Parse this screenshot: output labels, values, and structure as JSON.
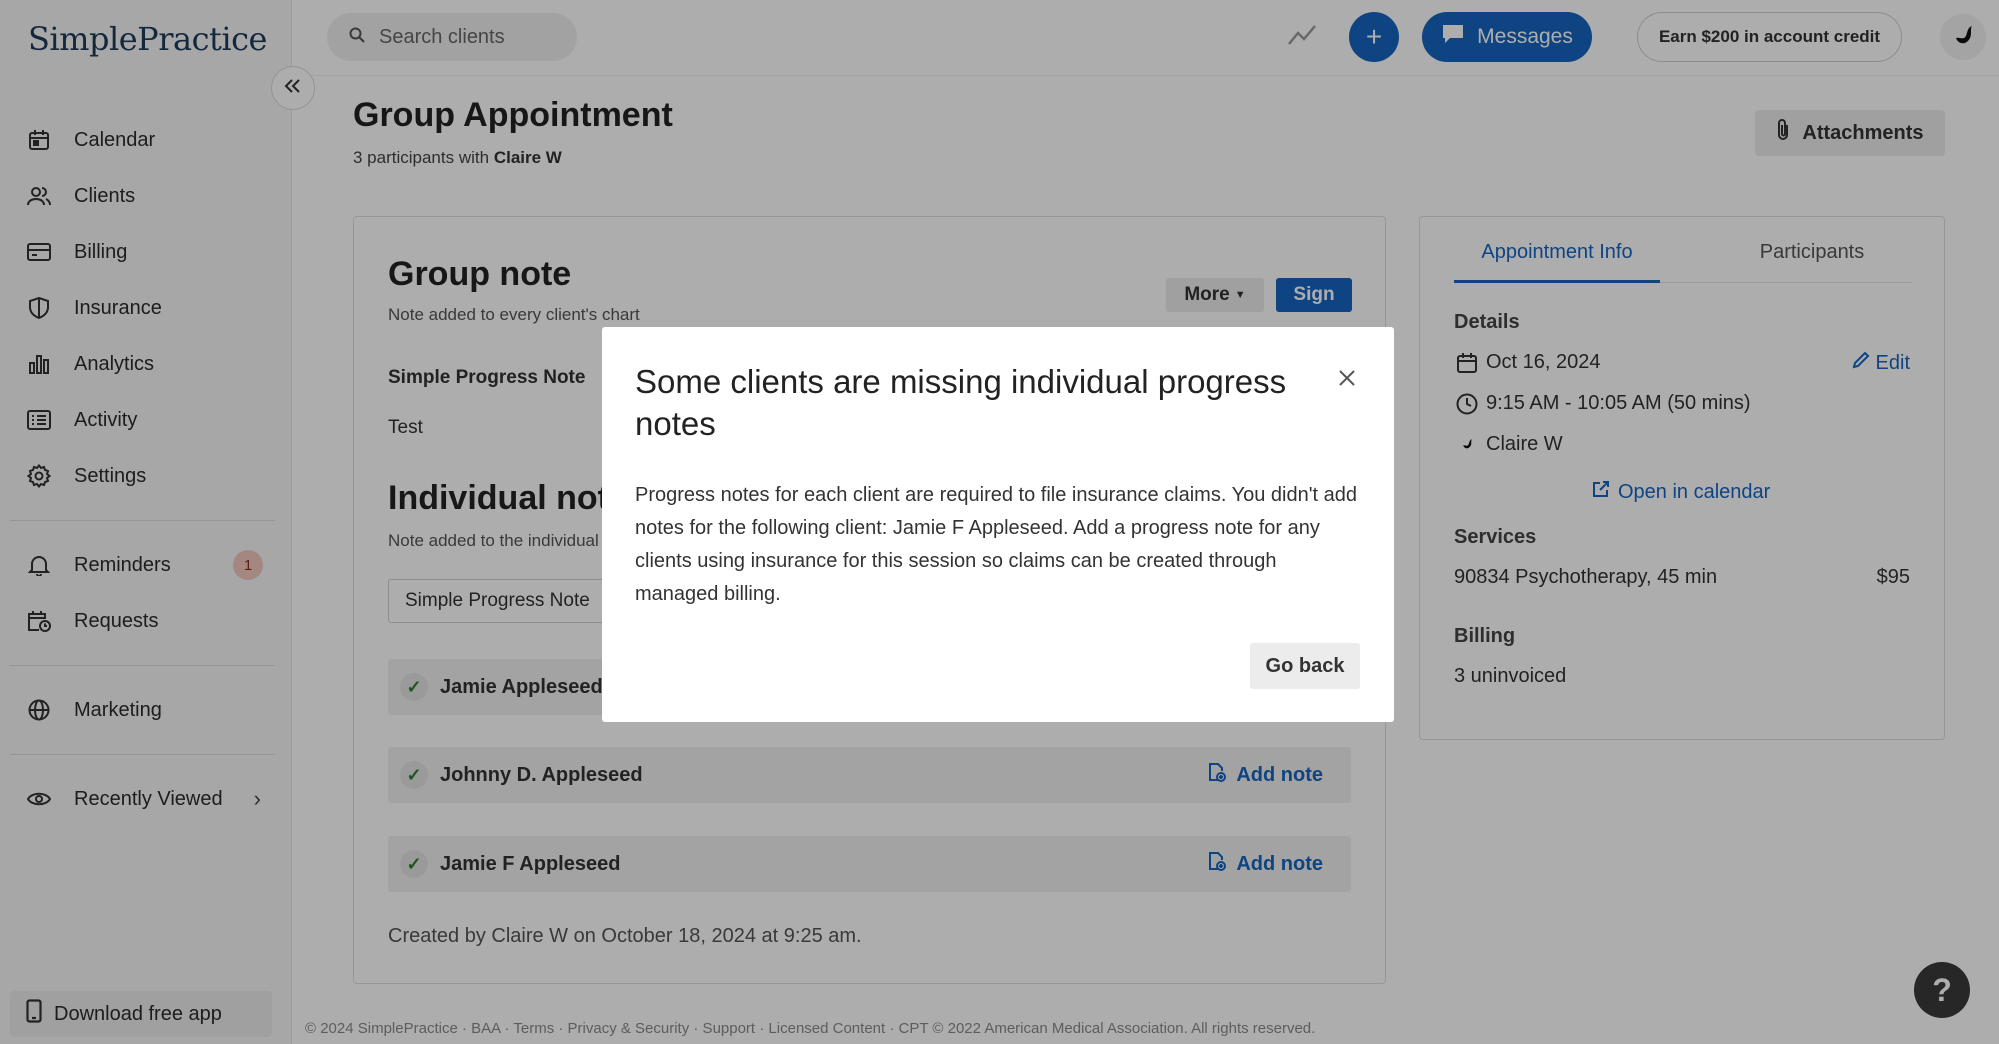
{
  "app": {
    "logo": "SimplePractice"
  },
  "sidebar": {
    "collapse_icon": "double-chevron-left-icon",
    "items": [
      {
        "label": "Calendar",
        "icon": "calendar-icon"
      },
      {
        "label": "Clients",
        "icon": "users-icon"
      },
      {
        "label": "Billing",
        "icon": "credit-card-icon"
      },
      {
        "label": "Insurance",
        "icon": "shield-icon"
      },
      {
        "label": "Analytics",
        "icon": "bar-chart-icon"
      },
      {
        "label": "Activity",
        "icon": "list-icon"
      },
      {
        "label": "Settings",
        "icon": "gear-icon"
      }
    ],
    "reminders": {
      "label": "Reminders",
      "badge": "1"
    },
    "requests": {
      "label": "Requests"
    },
    "marketing": {
      "label": "Marketing"
    },
    "recently_viewed": {
      "label": "Recently Viewed"
    },
    "download": {
      "label": "Download free app"
    }
  },
  "topbar": {
    "search_placeholder": "Search clients",
    "messages_label": "Messages",
    "credit_label": "Earn $200 in account credit"
  },
  "page": {
    "title": "Group Appointment",
    "subtitle_prefix": "3 participants with",
    "subtitle_name": "Claire W",
    "attachments_label": "Attachments"
  },
  "group_note": {
    "title": "Group note",
    "subtitle": "Note added to every client's chart",
    "more_label": "More",
    "sign_label": "Sign",
    "template_label": "Simple Progress Note",
    "text": "Test"
  },
  "individual_notes": {
    "title": "Individual notes",
    "subtitle": "Note added to the individual client's chart",
    "template_value": "Simple Progress Note",
    "clients": [
      {
        "name": "Jamie Appleseed",
        "action": ""
      },
      {
        "name": "Johnny D. Appleseed",
        "action": "Add note"
      },
      {
        "name": "Jamie F Appleseed",
        "action": "Add note"
      }
    ],
    "created_text": "Created by Claire W on October 18, 2024 at 9:25 am."
  },
  "info_panel": {
    "tabs": [
      "Appointment Info",
      "Participants"
    ],
    "details_label": "Details",
    "date": "Oct 16, 2024",
    "edit_label": "Edit",
    "time": "9:15 AM - 10:05 AM (50 mins)",
    "clinician": "Claire W",
    "open_calendar_label": "Open in calendar",
    "services_label": "Services",
    "service_name": "90834 Psychotherapy, 45 min",
    "service_price": "$95",
    "billing_label": "Billing",
    "billing_value": "3 uninvoiced"
  },
  "footer": {
    "text": "© 2024 SimplePractice · BAA · Terms · Privacy & Security · Support · Licensed Content · CPT © 2022 American Medical Association. All rights reserved."
  },
  "help_label": "?",
  "modal": {
    "title": "Some clients are missing individual progress notes",
    "body": "Progress notes for each client are required to file insurance claims. You didn't add notes for the following client: Jamie F Appleseed. Add a progress note for any clients using insurance for this session so claims can be created through managed billing.",
    "go_back_label": "Go back"
  },
  "colors": {
    "primary": "#1565c0",
    "overlay": "rgba(0,0,0,0.32)",
    "badge_bg": "#f4c7c0"
  }
}
